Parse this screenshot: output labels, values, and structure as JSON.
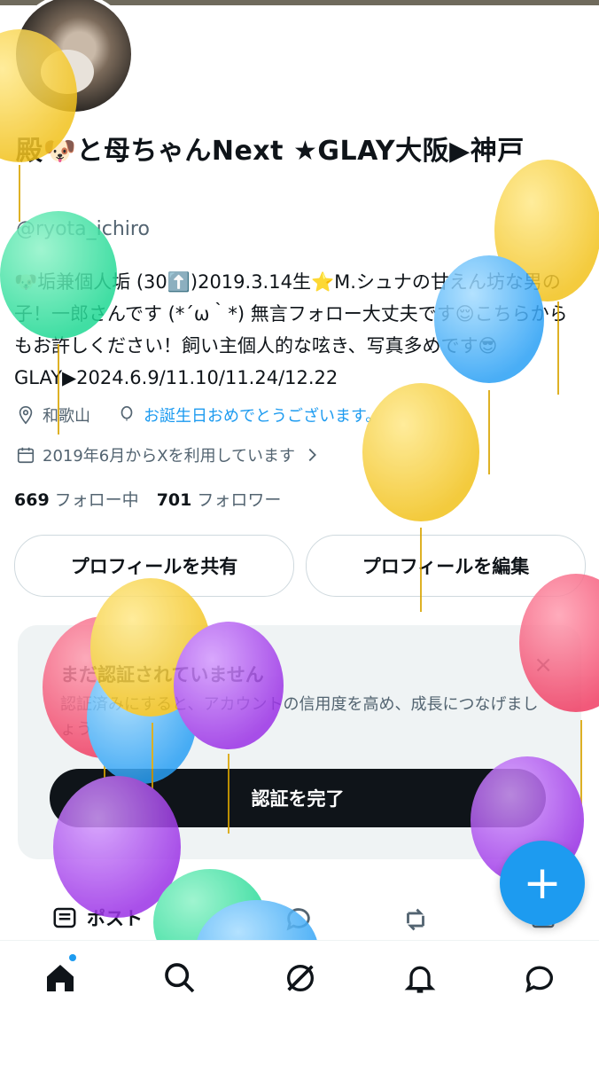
{
  "profile": {
    "name": "殿🐶と母ちゃんNext ★GLAY大阪▶︎神戸",
    "handle": "@ryota_ichiro",
    "bio": "🐶垢兼個人垢 (30⬆️)2019.3.14生⭐️M.シュナの甘えん坊な男の子！一郎さんです (*´ω｀*) 無言フォロー大丈夫です😌こちらからもお許しください！飼い主個人的な呟き、写真多めです😎 GLAY▶︎2024.6.9/11.10/11.24/12.22",
    "location": "和歌山",
    "birthday_link": "お誕生日おめでとうございます。",
    "joined": "2019年6月からXを利用しています",
    "following_count": "669",
    "following_label": "フォロー中",
    "followers_count": "701",
    "followers_label": "フォロワー"
  },
  "buttons": {
    "share": "プロフィールを共有",
    "edit": "プロフィールを編集"
  },
  "verify_card": {
    "title": "まだ認証されていません",
    "description": "認証済みにすると、アカウントの信用度を高め、成長につなげましょう",
    "button": "認証を完了",
    "close": "×"
  },
  "tabs": {
    "posts": "ポスト"
  },
  "fab": {
    "label": "+"
  },
  "colors": {
    "accent": "#1d9bf0",
    "text": "#0f1419",
    "secondary": "#536471"
  },
  "icons": [
    "location-icon",
    "birthday-balloon-icon",
    "calendar-icon",
    "chevron-right-icon",
    "home-icon",
    "search-icon",
    "grok-icon",
    "bell-icon",
    "messages-icon",
    "posts-icon",
    "reply-icon",
    "repost-icon",
    "media-icon"
  ]
}
